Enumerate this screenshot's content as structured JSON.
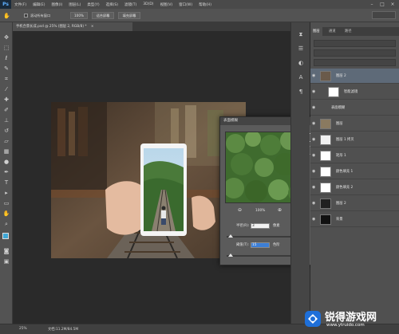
{
  "app": {
    "logo": "Ps"
  },
  "menu": [
    "文件(F)",
    "编辑(E)",
    "图像(I)",
    "图层(L)",
    "类型(Y)",
    "选择(S)",
    "滤镜(T)",
    "3D(D)",
    "视图(V)",
    "窗口(W)",
    "帮助(H)"
  ],
  "options": {
    "check_label": "滚动所有窗口",
    "zoom_value": "100%",
    "fit_button": "适合屏幕",
    "fill_button": "填充屏幕"
  },
  "document": {
    "tab_title": "手机合景长成.psd @ 25% (图层 2, RGB/8) *",
    "close": "×"
  },
  "dialog": {
    "title": "表面模糊",
    "ok": "确定",
    "cancel": "取消",
    "preview_label": "预览(P)",
    "zoom_percent": "100%",
    "radius_label": "半径(R):",
    "radius_value": "3",
    "radius_unit": "像素",
    "radius_level": 0.05,
    "threshold_label": "阈值(T):",
    "threshold_value": "15",
    "threshold_unit": "色阶",
    "threshold_level": 0.06
  },
  "layers_panel": {
    "tabs": [
      "图层",
      "通道",
      "路径"
    ],
    "rows": [
      {
        "name": "图层 2",
        "thumb": "#6a5a4a"
      },
      {
        "name": "智能滤镜",
        "thumb": "#ffffff"
      },
      {
        "name": "表面模糊",
        "thumb": ""
      },
      {
        "name": "图层",
        "thumb": "#8a7a60"
      },
      {
        "name": "图层 1 拷贝",
        "thumb": "#f0f0f0"
      },
      {
        "name": "矩形 1",
        "thumb": "#ffffff"
      },
      {
        "name": "颜色填充 1",
        "thumb": "#ffffff"
      },
      {
        "name": "颜色填充 2",
        "thumb": "#ffffff"
      },
      {
        "name": "图层 2",
        "thumb": "#202020"
      },
      {
        "name": "背景",
        "thumb": "#111111"
      }
    ]
  },
  "status": {
    "zoom": "25%",
    "doc_info": "文档:11.2M/84.5M"
  },
  "watermark": {
    "name": "锐得游戏网",
    "url": "www.ytruido.com"
  },
  "colors": {
    "accent": "#2d8ceb",
    "watermark_blue": "#1e6fd9"
  }
}
